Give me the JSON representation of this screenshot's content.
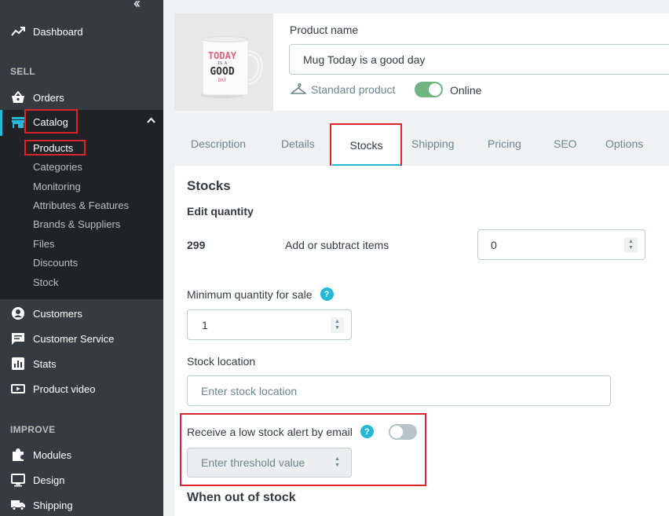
{
  "sidebar": {
    "dashboard": "Dashboard",
    "sections": {
      "sell": "SELL",
      "improve": "IMPROVE"
    },
    "sell_items": {
      "orders": "Orders",
      "catalog": "Catalog",
      "customers": "Customers",
      "customer_service": "Customer Service",
      "stats": "Stats",
      "product_video": "Product video"
    },
    "catalog_sub": [
      "Products",
      "Categories",
      "Monitoring",
      "Attributes & Features",
      "Brands & Suppliers",
      "Files",
      "Discounts",
      "Stock"
    ],
    "improve_items": {
      "modules": "Modules",
      "design": "Design",
      "shipping": "Shipping"
    }
  },
  "product": {
    "name_label": "Product name",
    "name_value": "Mug Today is a good day",
    "type": "Standard product",
    "status": "Online",
    "mug_text": {
      "line1": "TODAY",
      "line2": "IS A",
      "line3": "GOOD",
      "line4": "DAY"
    }
  },
  "tabs": [
    "Description",
    "Details",
    "Stocks",
    "Shipping",
    "Pricing",
    "SEO",
    "Options"
  ],
  "stocks": {
    "title": "Stocks",
    "edit_quantity": "Edit quantity",
    "current_qty": "299",
    "add_subtract_label": "Add or subtract items",
    "add_subtract_value": "0",
    "min_qty_label": "Minimum quantity for sale",
    "min_qty_value": "1",
    "location_label": "Stock location",
    "location_placeholder": "Enter stock location",
    "alert_label": "Receive a low stock alert by email",
    "threshold_placeholder": "Enter threshold value",
    "out_of_stock": "When out of stock",
    "help_glyph": "?"
  },
  "colors": {
    "sidebar_bg": "#363a41",
    "submenu_bg": "#202226",
    "accent": "#25b9d7",
    "toggle_on": "#70b580",
    "highlight": "#d9252b"
  }
}
